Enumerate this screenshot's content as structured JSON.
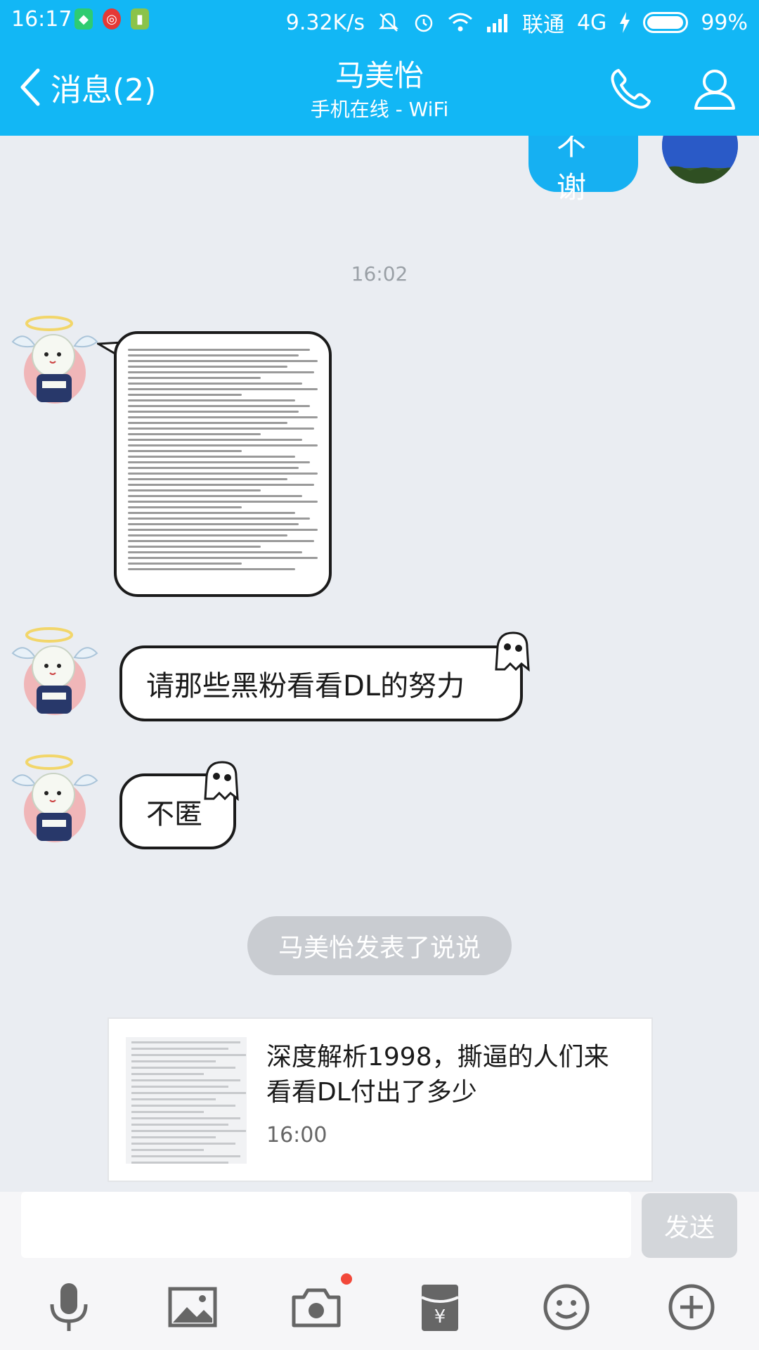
{
  "status_bar": {
    "time": "16:17",
    "speed": "9.32K/s",
    "carrier": "联通",
    "network": "4G",
    "battery": "99%",
    "battery_level": 0.99
  },
  "header": {
    "back_label": "消息(2)",
    "contact_name": "马美怡",
    "contact_status": "手机在线 - WiFi",
    "icons": [
      "phone-icon",
      "profile-icon"
    ]
  },
  "chat": {
    "my_message": "不谢",
    "timestamp": "16:02",
    "messages": [
      {
        "type": "image",
        "description_icon": "screenshot-image"
      },
      {
        "type": "text",
        "text": "请那些黑粉看看DL的努力"
      },
      {
        "type": "text",
        "text": "不匿"
      }
    ],
    "system_message": "马美怡发表了说说",
    "share_card": {
      "title": "深度解析1998，撕逼的人们来看看DL付出了多少",
      "time": "16:00"
    }
  },
  "input": {
    "placeholder": "",
    "send_label": "发送"
  },
  "toolbar": {
    "items": [
      "microphone-icon",
      "image-icon",
      "camera-icon",
      "red-packet-icon",
      "emoji-icon",
      "plus-icon"
    ]
  },
  "colors": {
    "header": "#12b7f5",
    "my_bubble": "#16b0f2",
    "background": "#eaedf2"
  }
}
